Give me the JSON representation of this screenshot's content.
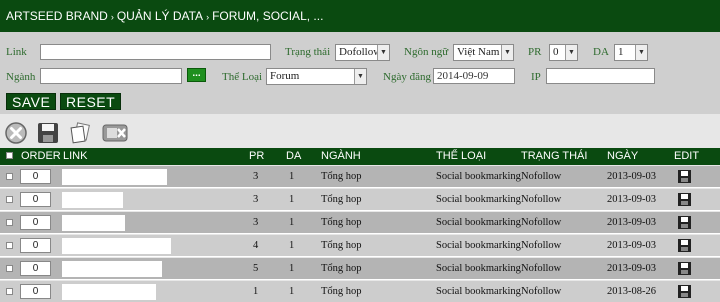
{
  "breadcrumb": [
    "ARTSEED BRAND",
    "QUẢN LÝ DATA",
    "FORUM, SOCIAL, ..."
  ],
  "breadcrumb_separator": "›",
  "filters": {
    "link_label": "Link",
    "trang_thai_label": "Trạng thái",
    "trang_thai_value": "Dofollow",
    "ngon_ngu_label": "Ngôn ngữ",
    "ngon_ngu_value": "Việt Nam",
    "pr_label": "PR",
    "pr_value": "0",
    "da_label": "DA",
    "da_value": "1",
    "nganh_label": "Ngành",
    "the_loai_label": "Thể Loại",
    "the_loai_value": "Forum",
    "ngay_dang_label": "Ngày đăng",
    "ngay_dang_value": "2014-09-09",
    "ip_label": "IP",
    "browse_button": "...",
    "save_button": "SAVE",
    "reset_button": "RESET"
  },
  "toolbar": [
    "delete-icon",
    "save-icon",
    "copy-icon",
    "export-icon"
  ],
  "table": {
    "headers": [
      "ORDER",
      "LINK",
      "PR",
      "DA",
      "NGÀNH",
      "THỂ LOẠI",
      "TRẠNG THÁI",
      "NGÀY",
      "EDIT"
    ],
    "rows": [
      {
        "order": "0",
        "pr": "3",
        "da": "1",
        "nganh": "Tổng hop",
        "the_loai": "Social bookmarking",
        "trang_thai": "Nofollow",
        "ngay": "2013-09-03"
      },
      {
        "order": "0",
        "pr": "3",
        "da": "1",
        "nganh": "Tổng hop",
        "the_loai": "Social bookmarking",
        "trang_thai": "Nofollow",
        "ngay": "2013-09-03"
      },
      {
        "order": "0",
        "pr": "3",
        "da": "1",
        "nganh": "Tổng hop",
        "the_loai": "Social bookmarking",
        "trang_thai": "Nofollow",
        "ngay": "2013-09-03"
      },
      {
        "order": "0",
        "pr": "4",
        "da": "1",
        "nganh": "Tổng hop",
        "the_loai": "Social bookmarking",
        "trang_thai": "Nofollow",
        "ngay": "2013-09-03"
      },
      {
        "order": "0",
        "pr": "5",
        "da": "1",
        "nganh": "Tổng hop",
        "the_loai": "Social bookmarking",
        "trang_thai": "Nofollow",
        "ngay": "2013-09-03"
      },
      {
        "order": "0",
        "pr": "1",
        "da": "1",
        "nganh": "Tổng hop",
        "the_loai": "Social bookmarking",
        "trang_thai": "Nofollow",
        "ngay": "2013-08-26"
      }
    ]
  }
}
